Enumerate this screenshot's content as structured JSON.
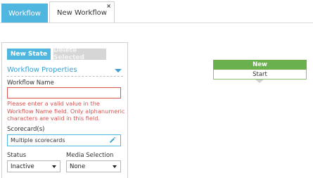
{
  "tabs": {
    "active_label": "Workflow",
    "second_label": "New Workflow",
    "close_glyph": "×"
  },
  "toolbar": {
    "new_state_label": "New State",
    "delete_selected_label": "Delete Selected"
  },
  "properties": {
    "title": "Workflow Properties",
    "workflow_name_label": "Workflow Name",
    "workflow_name_value": "",
    "workflow_name_error": "Please enter a valid value in the Workflow Name field. Only alphanumeric characters are valid in this field.",
    "scorecards_label": "Scorecard(s)",
    "scorecards_value": "Multiple scorecards",
    "status_label": "Status",
    "status_value": "Inactive",
    "media_selection_label": "Media Selection",
    "media_selection_value": "None"
  },
  "canvas": {
    "node_header": "New",
    "node_body": "Start"
  },
  "colors": {
    "accent": "#4fb6e0",
    "error": "#d9534f",
    "node_header": "#6ab04c"
  },
  "icons": {
    "edit": "pencil-icon",
    "collapse": "caret-down-icon",
    "close": "close-icon"
  }
}
